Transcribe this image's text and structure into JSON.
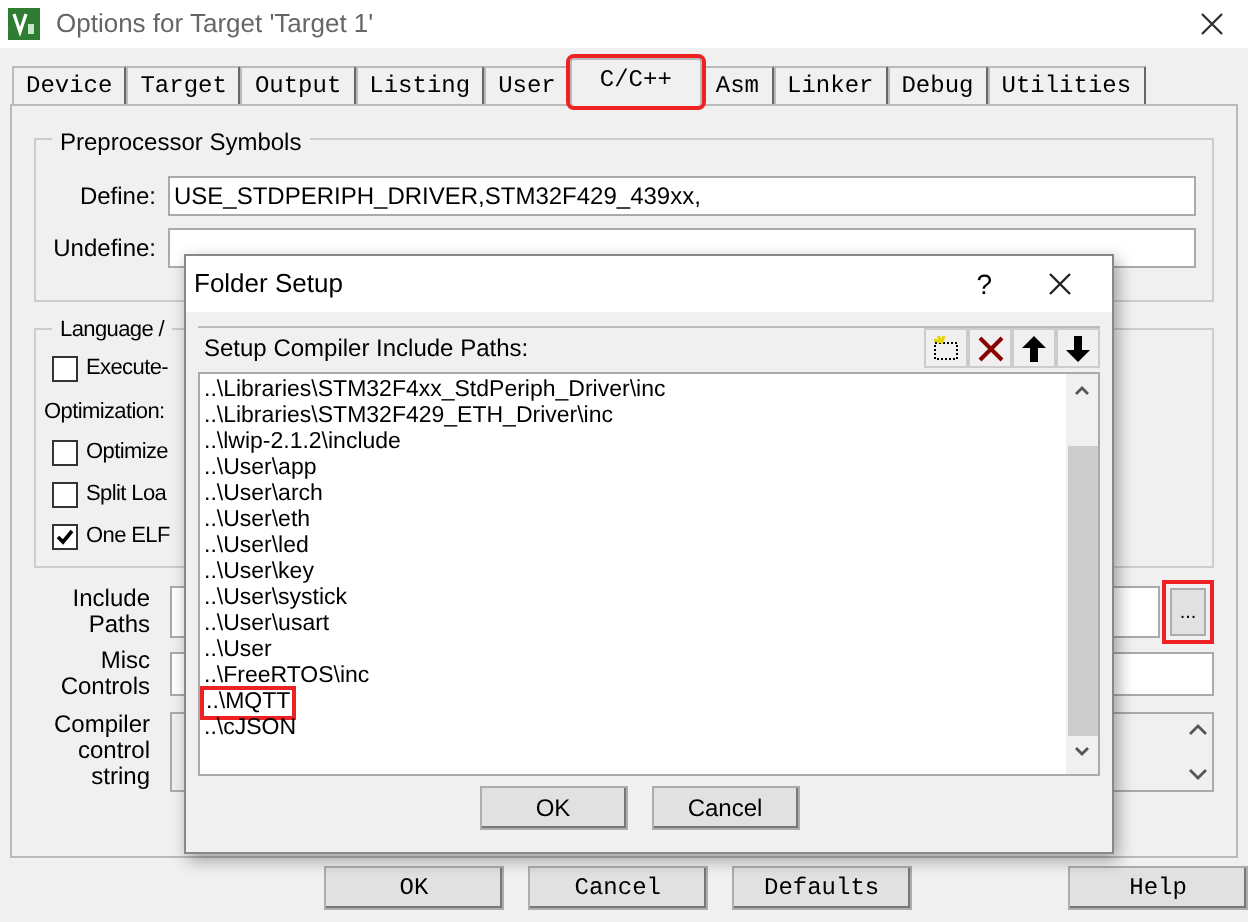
{
  "window": {
    "title": "Options for Target 'Target 1'"
  },
  "tabs": [
    {
      "label": "Device",
      "selected": false,
      "highlighted": false
    },
    {
      "label": "Target",
      "selected": false,
      "highlighted": false
    },
    {
      "label": "Output",
      "selected": false,
      "highlighted": false
    },
    {
      "label": "Listing",
      "selected": false,
      "highlighted": false
    },
    {
      "label": "User",
      "selected": false,
      "highlighted": false
    },
    {
      "label": "C/C++",
      "selected": true,
      "highlighted": true
    },
    {
      "label": "Asm",
      "selected": false,
      "highlighted": false
    },
    {
      "label": "Linker",
      "selected": false,
      "highlighted": false
    },
    {
      "label": "Debug",
      "selected": false,
      "highlighted": false
    },
    {
      "label": "Utilities",
      "selected": false,
      "highlighted": false
    }
  ],
  "preprocessor": {
    "title": "Preprocessor Symbols",
    "define_label": "Define:",
    "define_value": "USE_STDPERIPH_DRIVER,STM32F429_439xx,",
    "undefine_label": "Undefine:"
  },
  "language": {
    "title": "Language /",
    "items": [
      {
        "kind": "checkbox",
        "label": "Execute-",
        "checked": false
      },
      {
        "kind": "label",
        "label": "Optimization:"
      },
      {
        "kind": "checkbox",
        "label": "Optimize",
        "checked": false
      },
      {
        "kind": "checkbox",
        "label": "Split Loa",
        "checked": false
      },
      {
        "kind": "checkbox",
        "label": "One ELF",
        "checked": true
      }
    ]
  },
  "include_paths": {
    "label": "Include Paths",
    "browse_button": "...",
    "highlighted": true
  },
  "misc_controls": {
    "label": "Misc Controls"
  },
  "compiler_control": {
    "label": "Compiler control string"
  },
  "buttons": [
    "OK",
    "Cancel",
    "Defaults",
    "Help"
  ],
  "folder_setup": {
    "title": "Folder Setup",
    "help": "?",
    "list_title": "Setup Compiler Include Paths:",
    "paths": [
      {
        "text": "..\\Libraries\\STM32F4xx_StdPeriph_Driver\\inc",
        "highlighted": false
      },
      {
        "text": "..\\Libraries\\STM32F429_ETH_Driver\\inc",
        "highlighted": false
      },
      {
        "text": "..\\lwip-2.1.2\\include",
        "highlighted": false
      },
      {
        "text": "..\\User\\app",
        "highlighted": false
      },
      {
        "text": "..\\User\\arch",
        "highlighted": false
      },
      {
        "text": "..\\User\\eth",
        "highlighted": false
      },
      {
        "text": "..\\User\\led",
        "highlighted": false
      },
      {
        "text": "..\\User\\key",
        "highlighted": false
      },
      {
        "text": "..\\User\\systick",
        "highlighted": false
      },
      {
        "text": "..\\User\\usart",
        "highlighted": false
      },
      {
        "text": "..\\User",
        "highlighted": false
      },
      {
        "text": "..\\FreeRTOS\\inc",
        "highlighted": false
      },
      {
        "text": "..\\MQTT",
        "highlighted": true
      },
      {
        "text": "..\\cJSON",
        "highlighted": false
      }
    ],
    "buttons": [
      "OK",
      "Cancel"
    ]
  }
}
